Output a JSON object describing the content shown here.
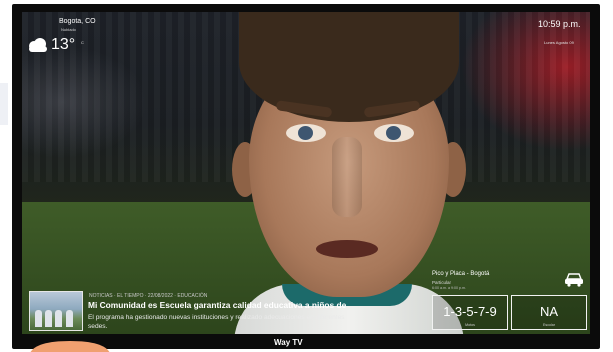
{
  "weather": {
    "location": "Bogota, CO",
    "location_sub": "Nublado",
    "temperature": "13°",
    "temperature_unit": "C",
    "icon": "cloudy-icon"
  },
  "clock": {
    "time": "10:59 p.m.",
    "date": "Lunes Agosto 09"
  },
  "news": {
    "meta": "NOTICIAS · EL TIEMPO · 22/08/2022 · EDUCACIÓN",
    "title": "Mi Comunidad es Escuela garantiza calidad educativa a niños de",
    "body": "El programa ha gestionado nuevas instituciones y realizado adecuaciones en diferentes sedes."
  },
  "pico_y_placa": {
    "title": "Pico y Placa - Bogotá",
    "subtitle": "Particular",
    "schedule": "6:00 a.m. a 9:00 p.m.",
    "restricted_plates": "1-3-5-7-9",
    "restricted_caption": "Motos",
    "other_value": "NA",
    "other_caption": "Escolar",
    "icon": "car-icon"
  },
  "brand": "Way TV",
  "colors": {
    "accent_orange": "#f0a070",
    "bezel": "#0b0b0b"
  }
}
